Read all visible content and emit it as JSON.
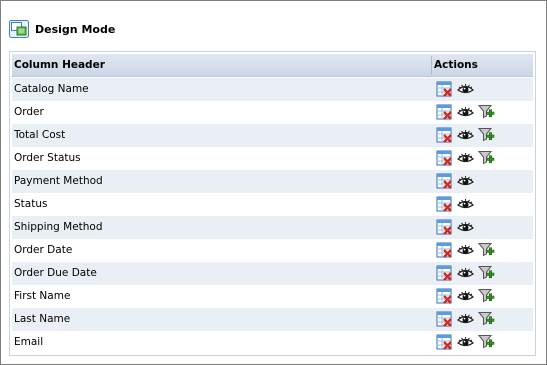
{
  "panel": {
    "title": "Design Mode",
    "icon": "design-mode-icon"
  },
  "grid": {
    "headers": {
      "column": "Column Header",
      "actions": "Actions"
    },
    "rows": [
      {
        "label": "Catalog Name",
        "actions": [
          "delete-column-icon",
          "visibility-eye-icon"
        ]
      },
      {
        "label": "Order",
        "actions": [
          "delete-column-icon",
          "visibility-eye-icon",
          "add-filter-icon"
        ]
      },
      {
        "label": "Total Cost",
        "actions": [
          "delete-column-icon",
          "visibility-eye-icon",
          "add-filter-icon"
        ]
      },
      {
        "label": "Order Status",
        "actions": [
          "delete-column-icon",
          "visibility-eye-icon",
          "add-filter-icon"
        ]
      },
      {
        "label": "Payment Method",
        "actions": [
          "delete-column-icon",
          "visibility-eye-icon"
        ]
      },
      {
        "label": "Status",
        "actions": [
          "delete-column-icon",
          "visibility-eye-icon"
        ]
      },
      {
        "label": "Shipping Method",
        "actions": [
          "delete-column-icon",
          "visibility-eye-icon"
        ]
      },
      {
        "label": "Order Date",
        "actions": [
          "delete-column-icon",
          "visibility-eye-icon",
          "add-filter-icon"
        ]
      },
      {
        "label": "Order Due Date",
        "actions": [
          "delete-column-icon",
          "visibility-eye-icon",
          "add-filter-icon"
        ]
      },
      {
        "label": "First Name",
        "actions": [
          "delete-column-icon",
          "visibility-eye-icon",
          "add-filter-icon"
        ]
      },
      {
        "label": "Last Name",
        "actions": [
          "delete-column-icon",
          "visibility-eye-icon",
          "add-filter-icon"
        ]
      },
      {
        "label": "Email",
        "actions": [
          "delete-column-icon",
          "visibility-eye-icon",
          "add-filter-icon"
        ]
      }
    ]
  },
  "colors": {
    "header_bg": "#d3ddeb",
    "alt_row_bg": "#eaeef5",
    "border": "#c6d3e3",
    "delete_red": "#d42a1e",
    "filter_green": "#3a9a2a"
  }
}
